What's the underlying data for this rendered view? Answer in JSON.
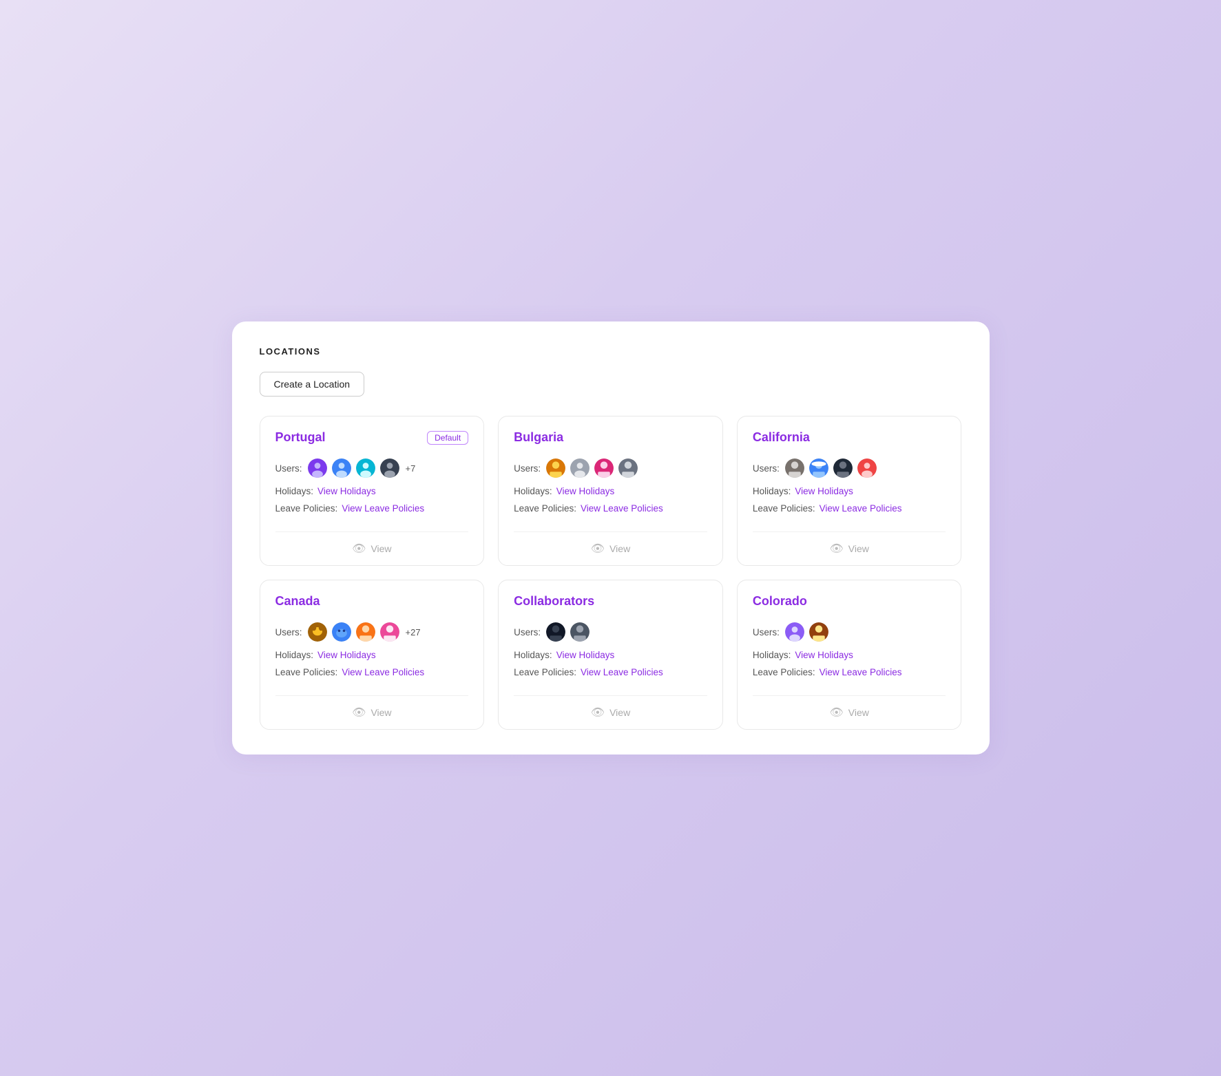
{
  "page": {
    "title": "LOCATIONS",
    "create_button": "Create a Location"
  },
  "locations": [
    {
      "id": "portugal",
      "name": "Portugal",
      "is_default": true,
      "default_label": "Default",
      "users_label": "Users:",
      "holidays_label": "Holidays:",
      "leave_label": "Leave Policies:",
      "view_holidays_link": "View Holidays",
      "view_leave_link": "View Leave Policies",
      "view_label": "View",
      "user_count": "+7",
      "avatars": [
        "purple-person",
        "dark-person",
        "teal-person",
        "dark-silhouette"
      ]
    },
    {
      "id": "bulgaria",
      "name": "Bulgaria",
      "is_default": false,
      "default_label": "",
      "users_label": "Users:",
      "holidays_label": "Holidays:",
      "leave_label": "Leave Policies:",
      "view_holidays_link": "View Holidays",
      "view_leave_link": "View Leave Policies",
      "view_label": "View",
      "user_count": "",
      "avatars": [
        "man1",
        "gray-person",
        "woman1",
        "man2"
      ]
    },
    {
      "id": "california",
      "name": "California",
      "is_default": false,
      "default_label": "",
      "users_label": "Users:",
      "holidays_label": "Holidays:",
      "leave_label": "Leave Policies:",
      "view_holidays_link": "View Holidays",
      "view_leave_link": "View Leave Policies",
      "view_label": "View",
      "user_count": "",
      "avatars": [
        "oldman",
        "smurf",
        "darkman",
        "red-person"
      ]
    },
    {
      "id": "canada",
      "name": "Canada",
      "is_default": false,
      "default_label": "",
      "users_label": "Users:",
      "holidays_label": "Holidays:",
      "leave_label": "Leave Policies:",
      "view_holidays_link": "View Holidays",
      "view_leave_link": "View Leave Policies",
      "view_label": "View",
      "user_count": "+27",
      "avatars": [
        "dog-avatar",
        "stitch",
        "orange-person",
        "girl1"
      ]
    },
    {
      "id": "collaborators",
      "name": "Collaborators",
      "is_default": false,
      "default_label": "",
      "users_label": "Users:",
      "holidays_label": "Holidays:",
      "leave_label": "Leave Policies:",
      "view_holidays_link": "View Holidays",
      "view_leave_link": "View Leave Policies",
      "view_label": "View",
      "user_count": "",
      "avatars": [
        "dark-face",
        "man3"
      ]
    },
    {
      "id": "colorado",
      "name": "Colorado",
      "is_default": false,
      "default_label": "",
      "users_label": "Users:",
      "holidays_label": "Holidays:",
      "leave_label": "Leave Policies:",
      "view_holidays_link": "View Holidays",
      "view_leave_link": "View Leave Policies",
      "view_label": "View",
      "user_count": "",
      "avatars": [
        "purple-person2",
        "tan-man"
      ]
    }
  ]
}
